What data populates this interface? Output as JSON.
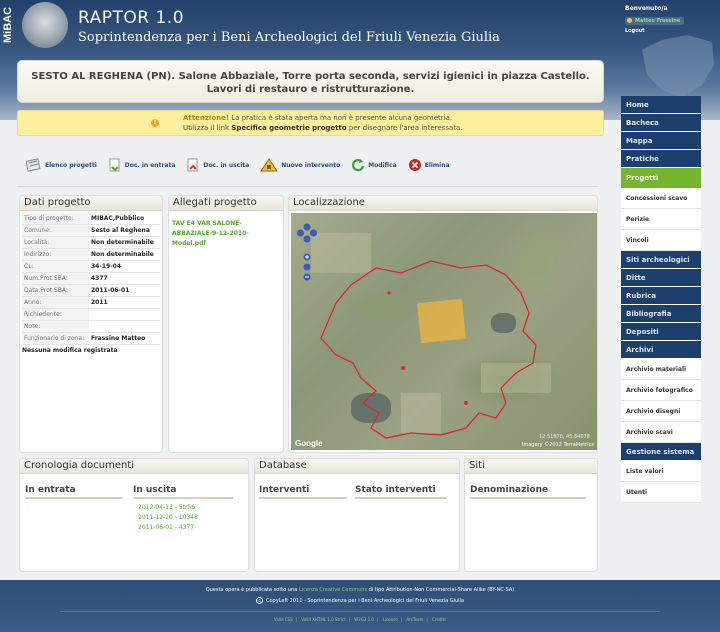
{
  "header": {
    "logo_text": "MiBAC",
    "app_title": "RAPTOR 1.0",
    "app_subtitle": "Soprintendenza per i Beni Archeologici del Friuli Venezia Giulia",
    "welcome": "Benvenuto/a",
    "user_name": "Matteo Frassine",
    "logout": "Logout"
  },
  "page_title": "SESTO AL REGHENA (PN). Salone Abbaziale, Torre porta seconda, servizi igienici in piazza Castello. Lavori di restauro e ristrutturazione.",
  "warning": {
    "label": "Attenzione!",
    "line1": "La pratica è stata aperta ma non è presente alcuna geometria.",
    "line2_pre": "Utilizza il link",
    "line2_link": "Specifica geometrie progetto",
    "line2_post": "per disegnare l'area interessata."
  },
  "toolbar": {
    "elenco": "Elenco progetti",
    "doc_entrata": "Doc. in entrata",
    "doc_uscita": "Doc. in uscita",
    "nuovo": "Nuovo intervento",
    "modifica": "Modifica",
    "elimina": "Elimina"
  },
  "dati": {
    "title": "Dati progetto",
    "rows": [
      {
        "k": "Tipo di progetto:",
        "v": "MIBAC,Pubblico"
      },
      {
        "k": "Comune:",
        "v": "Sesto al Reghena"
      },
      {
        "k": "Località:",
        "v": "Non determinabile"
      },
      {
        "k": "Indirizzo:",
        "v": "Non determinabile"
      },
      {
        "k": "CL:",
        "v": "34-19-04"
      },
      {
        "k": "Num.Prot.SBA:",
        "v": "4377"
      },
      {
        "k": "Data.Prot.SBA:",
        "v": "2011-06-01"
      },
      {
        "k": "Anno:",
        "v": "2011"
      },
      {
        "k": "Richiedente:",
        "v": ""
      },
      {
        "k": "Note:",
        "v": ""
      },
      {
        "k": "Funzionario di zona:",
        "v": "Frassine Matteo"
      }
    ],
    "no_changes": "Nessuna modifica registrata"
  },
  "allegati": {
    "title": "Allegati progetto",
    "file": "TAV E4 VAR SALONE-ABBAZIALE-9-12-2010-Model.pdf"
  },
  "localizzazione": {
    "title": "Localizzazione",
    "attribution": "Imagery ©2012 TerraMetrics",
    "scale": "12.51870, 45.84078",
    "google": "Google"
  },
  "cronologia": {
    "title": "Cronologia documenti",
    "in_entrata": "In entrata",
    "in_uscita": "In uscita",
    "uscita_items": [
      "2012-04-13 - 5tr56",
      "2011-12-20 - 10348",
      "2011-06-01 - 4377"
    ]
  },
  "database": {
    "title": "Database",
    "interventi": "Interventi",
    "stato": "Stato interventi"
  },
  "siti": {
    "title": "Siti",
    "denominazione": "Denominazione"
  },
  "nav": [
    {
      "label": "Home",
      "type": "main"
    },
    {
      "label": "Bacheca",
      "type": "main"
    },
    {
      "label": "Mappa",
      "type": "main"
    },
    {
      "label": "Pratiche",
      "type": "main"
    },
    {
      "label": "Progetti",
      "type": "active"
    },
    {
      "label": "Concessioni scavo",
      "type": "sub"
    },
    {
      "label": "Perizie",
      "type": "sub"
    },
    {
      "label": "Vincoli",
      "type": "sub"
    },
    {
      "label": "Siti archeologici",
      "type": "main"
    },
    {
      "label": "Ditte",
      "type": "main"
    },
    {
      "label": "Rubrica",
      "type": "main"
    },
    {
      "label": "Bibliografia",
      "type": "main"
    },
    {
      "label": "Depositi",
      "type": "main"
    },
    {
      "label": "Archivi",
      "type": "main"
    },
    {
      "label": "Archivio materiali",
      "type": "sub"
    },
    {
      "label": "Archivio fotografico",
      "type": "sub"
    },
    {
      "label": "Archivio disegni",
      "type": "sub"
    },
    {
      "label": "Archivio scavi",
      "type": "sub"
    },
    {
      "label": "Gestione sistema",
      "type": "main"
    },
    {
      "label": "Liste valori",
      "type": "sub"
    },
    {
      "label": "Utenti",
      "type": "sub"
    }
  ],
  "footer": {
    "line1_pre": "Questa opera è pubblicata sotto una",
    "line1_link": "Licenza Creative Commons",
    "line1_post": "di tipo Attribution-Non Commercial-Share Alike (BY-NC-SA)",
    "line2": "CopyLeft 2011 - Soprintendenza per i Beni Archeologici del Friuli Venezia Giulia",
    "links": [
      "Valid CSS",
      "Valid XHTML 1.0 Strict",
      "W3G3 1.0",
      "License",
      "ArcTeam",
      "Credits"
    ]
  },
  "colors": {
    "nav_main": "#1d3f6e",
    "nav_active": "#76b530",
    "link_green": "#58a52d",
    "warning_bg": "#fcef9e"
  }
}
